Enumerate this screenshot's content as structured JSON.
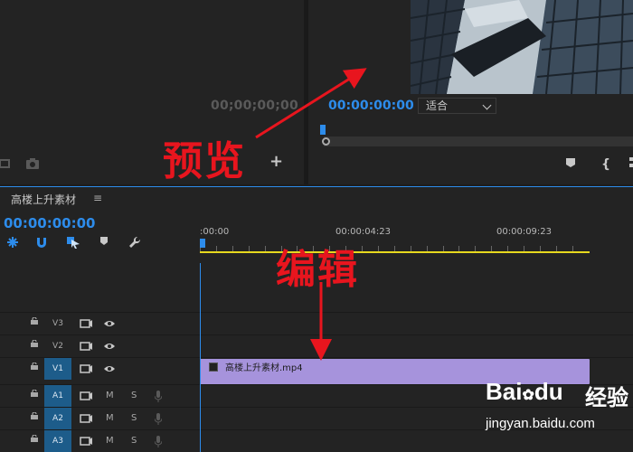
{
  "source_monitor": {
    "timecode": "00;00;00;00",
    "buttons": [
      "export-frame",
      "camera",
      "add"
    ]
  },
  "program_monitor": {
    "timecode": "00:00:00:00",
    "fit_option": "适合"
  },
  "timeline": {
    "sequence_name": "高楼上升素材",
    "menu_glyph": "≡",
    "timecode": "00:00:00:00",
    "ruler_labels": [
      ":00:00",
      "00:00:04:23",
      "00:00:09:23"
    ],
    "tracks": [
      {
        "id": "V3",
        "type": "video",
        "targeted": false
      },
      {
        "id": "V2",
        "type": "video",
        "targeted": false
      },
      {
        "id": "V1",
        "type": "video",
        "targeted": true
      },
      {
        "id": "A1",
        "type": "audio",
        "targeted": true
      },
      {
        "id": "A2",
        "type": "audio",
        "targeted": true
      },
      {
        "id": "A3",
        "type": "audio",
        "targeted": true
      }
    ],
    "mute_label": "M",
    "solo_label": "S",
    "clip": {
      "name": "高楼上升素材.mp4",
      "track": "V1"
    }
  },
  "annotations": {
    "preview": "预览",
    "edit": "编辑",
    "color": "#e8151e"
  },
  "watermark": {
    "logo": "Bai",
    "logo_suffix": "du",
    "jingyan": "经验",
    "url": "jingyan.baidu.com"
  },
  "colors": {
    "accent": "#2d8ceb",
    "work_area": "#e6d81e",
    "clip": "#a693dc",
    "track_target": "#1d5c8a"
  }
}
